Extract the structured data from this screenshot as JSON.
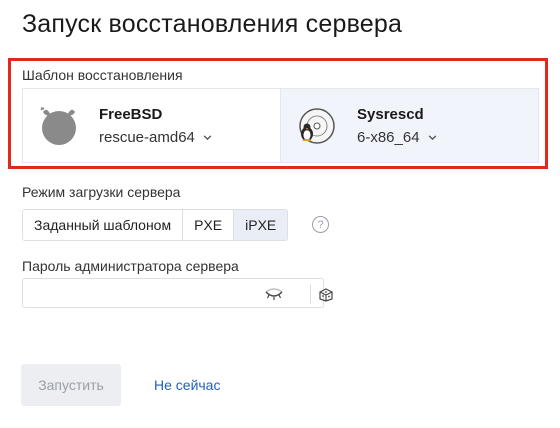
{
  "page": {
    "title": "Запуск восстановления сервера"
  },
  "template": {
    "label": "Шаблон восстановления",
    "options": [
      {
        "name": "FreeBSD",
        "version": "rescue-amd64",
        "icon": "freebsd-daemon-icon"
      },
      {
        "name": "Sysrescd",
        "version": "6-x86_64",
        "icon": "sysrescue-disc-penguin-icon"
      }
    ]
  },
  "boot_mode": {
    "label": "Режим загрузки сервера",
    "options": [
      "Заданный шаблоном",
      "PXE",
      "iPXE"
    ],
    "selected": "iPXE",
    "help_symbol": "?"
  },
  "password": {
    "label": "Пароль администратора сервера",
    "value": "",
    "placeholder": ""
  },
  "actions": {
    "start_label": "Запустить",
    "later_label": "Не сейчас"
  },
  "colors": {
    "highlight": "#e2281d",
    "link": "#1f5fbf",
    "selected_bg": "#e9eef6",
    "card_alt_bg": "#f1f5fb"
  }
}
